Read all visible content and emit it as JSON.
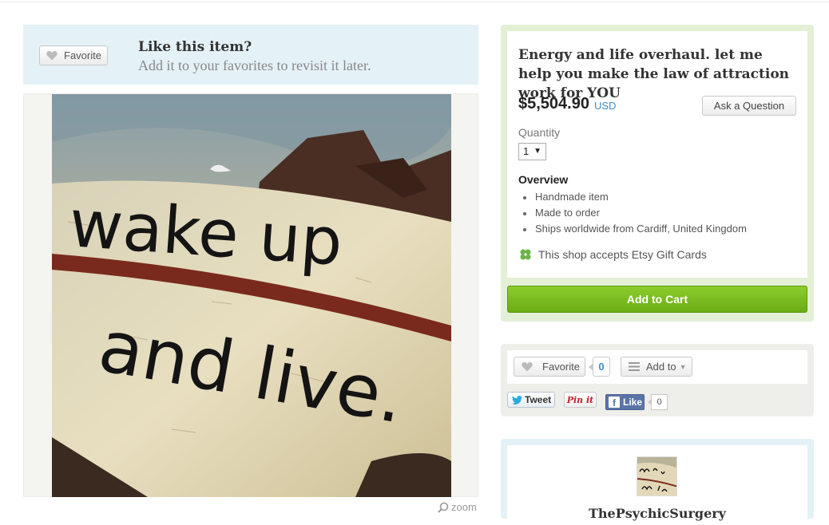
{
  "favorite_banner": {
    "button_label": "Favorite",
    "title": "Like this item?",
    "subtitle": "Add it to your favorites to revisit it later."
  },
  "listing_image": {
    "text_line1": "wake up",
    "text_line2": "and live."
  },
  "zoom_label": "zoom",
  "item": {
    "title": "Energy and life overhaul. let me help you make the law of attraction work for YOU",
    "price": "$5,504.90",
    "currency": "USD",
    "ask_label": "Ask a Question",
    "quantity_label": "Quantity",
    "quantity_value": "1",
    "overview_title": "Overview",
    "overview_items": [
      "Handmade item",
      "Made to order",
      "Ships worldwide from Cardiff, United Kingdom"
    ],
    "gift_card_text": "This shop accepts Etsy Gift Cards",
    "add_to_cart_label": "Add to Cart"
  },
  "social": {
    "favorite_label": "Favorite",
    "favorite_count": "0",
    "add_to_label": "Add to",
    "tweet_label": "Tweet",
    "pinit_label": "Pin it",
    "like_label": "Like",
    "like_count": "0"
  },
  "shop": {
    "name": "ThePsychicSurgery"
  },
  "colors": {
    "banner_bg": "#e4f1f6",
    "buy_box_bg": "#e3f0d6",
    "add_to_cart_green": "#77b81c",
    "price_currency_blue": "#3f8fc8",
    "facebook_blue": "#5b74a8",
    "pinterest_red": "#cb2027"
  },
  "icons": [
    "heart-icon",
    "hamburger-icon",
    "twitter-bird-icon",
    "facebook-f-icon",
    "clover-icon",
    "magnifier-icon"
  ]
}
